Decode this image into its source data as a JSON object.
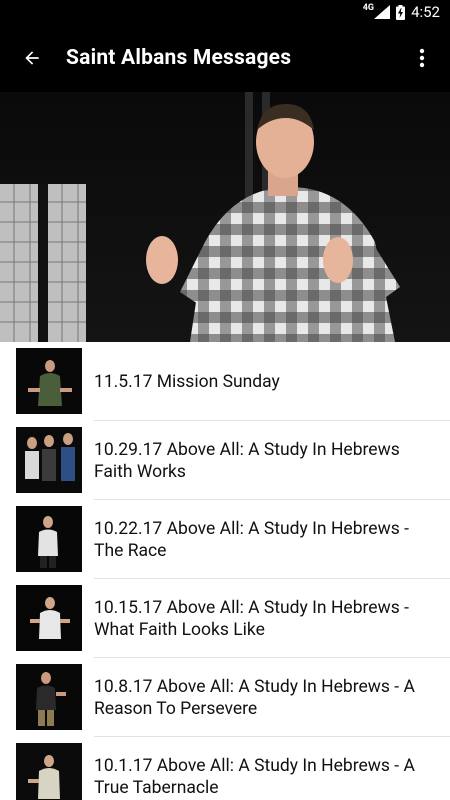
{
  "status_bar": {
    "network": "4G",
    "time": "4:52"
  },
  "app_bar": {
    "title": "Saint Albans Messages",
    "back_icon": "arrow-back-icon",
    "menu_icon": "more-vert-icon"
  },
  "messages": [
    {
      "title": "11.5.17 Mission Sunday"
    },
    {
      "title": "10.29.17 Above All: A Study In Hebrews Faith Works"
    },
    {
      "title": "10.22.17 Above All: A Study In Hebrews - The Race"
    },
    {
      "title": "10.15.17 Above All: A Study In Hebrews - What Faith Looks Like"
    },
    {
      "title": "10.8.17 Above All: A Study In Hebrews - A Reason To Persevere"
    },
    {
      "title": "10.1.17 Above All: A Study In Hebrews - A True Tabernacle"
    }
  ],
  "colors": {
    "app_bar": "#000000",
    "list_background": "#ffffff",
    "divider": "#e3e3e3"
  }
}
